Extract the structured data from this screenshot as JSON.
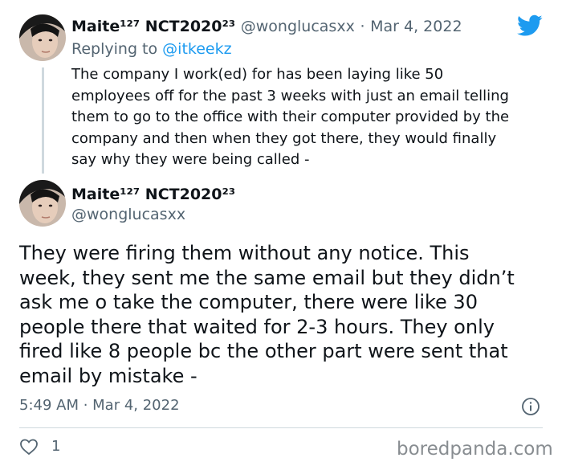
{
  "reply_tweet": {
    "display_name": "Maite¹²⁷ NCT2020²³",
    "handle": "@wonglucasxx",
    "separator": "·",
    "date": "Mar 4, 2022",
    "replying_prefix": "Replying to",
    "replying_handle": "@itkeekz",
    "text_lines": [
      "The company I work(ed) for has been laying like 50",
      "employees off for the past 3 weeks with just an email telling",
      "them to go to the office with their computer provided by the",
      "company and then when they got there, they would finally",
      "say why they were being called -"
    ]
  },
  "main_tweet": {
    "display_name": "Maite¹²⁷ NCT2020²³",
    "handle": "@wonglucasxx",
    "text_lines": [
      "They were firing them without any notice. This",
      "week, they sent me the same email but they didn’t",
      "ask me o take the computer, there were like 30",
      "people there that waited for 2-3 hours. They only",
      "fired like 8 people bc the other part were sent that",
      "email by mistake -"
    ],
    "timestamp": "5:49 AM · Mar 4, 2022",
    "like_count": "1"
  },
  "watermark": "boredpanda.com",
  "icons": {
    "logo": "twitter-bird-icon",
    "info": "info-icon",
    "like": "heart-icon"
  },
  "colors": {
    "twitter_blue": "#1d9bf0",
    "text": "#0f1419",
    "secondary": "#536471",
    "line": "#cfd9de"
  }
}
